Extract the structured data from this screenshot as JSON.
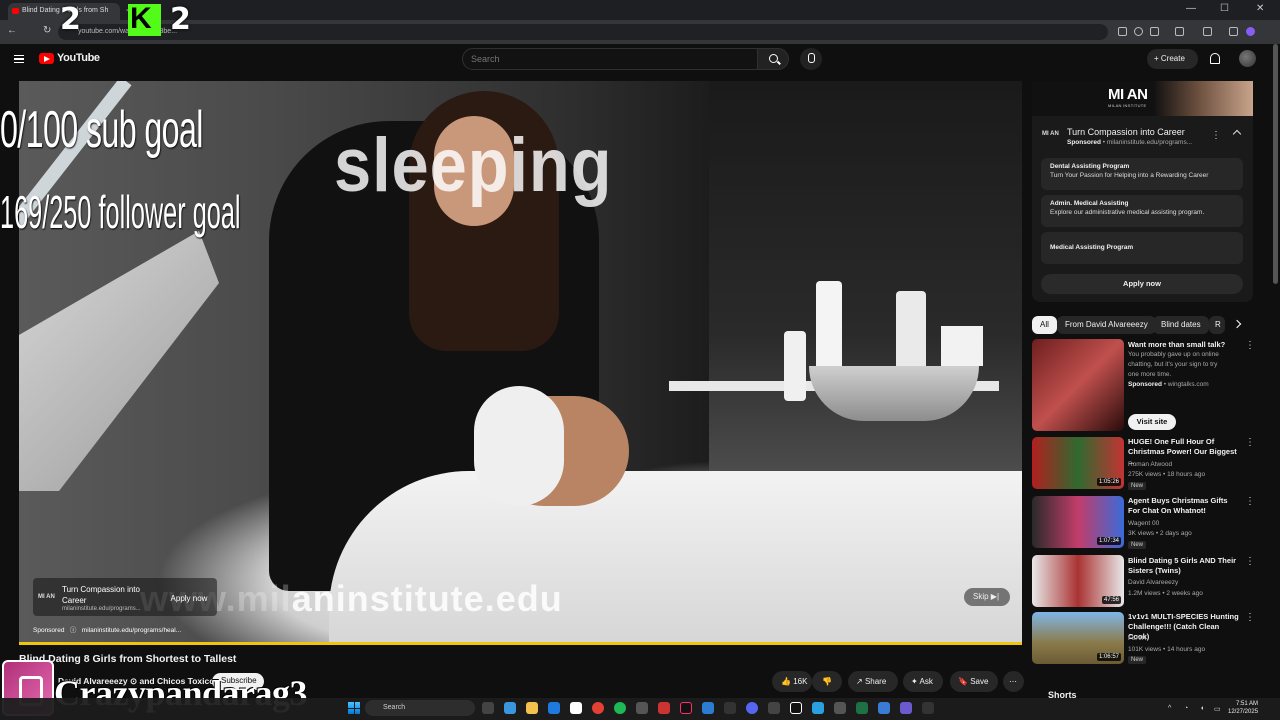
{
  "browser": {
    "tab_title": "Blind Dating 8 Girls from Sh",
    "url": "youtube.com/watch?v=...13be...",
    "new_tab": "+",
    "win_minimize": "—",
    "win_maximize": "☐",
    "win_close": "✕",
    "back": "←",
    "reload": "↻"
  },
  "stream_overlay": {
    "counter_1": "2",
    "kick_letter": "K",
    "counter_2": "2",
    "sub_goal": "0/100 sub goal",
    "follower_goal": "169/250 follower goal",
    "sleeping": "sleeping",
    "streamer_name": "Crazypandarag3"
  },
  "masthead": {
    "logo_text": "YouTube",
    "search_placeholder": "Search",
    "create_label": "Create"
  },
  "player": {
    "watermark_dim": "www.mil",
    "watermark_text": "aninstitute.edu",
    "ad_logo": "MI AN",
    "ad_title": "Turn Compassion into Career",
    "ad_url": "milaninstitute.edu/programs...",
    "ad_apply": "Apply now",
    "sponsored_label": "Sponsored",
    "sponsored_info": "ⓘ",
    "sponsored_url": "milaninstitute.edu/programs/heal...",
    "skip_label": "Skip",
    "skip_icon": "▶|",
    "progress_color": "#f1c40f"
  },
  "video": {
    "title": "Blind Dating 8 Girls from Shortest to Tallest",
    "channel": "David Alvareeezy",
    "collab": "and Chicos Toxicos",
    "subscribe_label": "Subscribe",
    "likes": "16K",
    "share_label": "Share",
    "ask_label": "Ask",
    "save_label": "Save",
    "more": "⋯"
  },
  "sidebar_ad": {
    "banner_logo": "MI AN",
    "banner_sub": "MILAN INSTITUTE",
    "logo": "MI AN",
    "title": "Turn Compassion into Career",
    "sponsored": "Sponsored",
    "domain": "milaninstitute.edu/programs...",
    "programs": [
      {
        "title": "Dental Assisting Program",
        "desc": "Turn Your Passion for Helping into a Rewarding Career"
      },
      {
        "title": "Admin. Medical Assisting",
        "desc": "Explore our administrative medical assisting program."
      },
      {
        "title": "Medical Assisting Program",
        "desc": ""
      }
    ],
    "apply_label": "Apply now"
  },
  "chips": [
    "All",
    "From David Alvareeezy",
    "Blind dates",
    "R"
  ],
  "recommendations": [
    {
      "title": "Want more than small talk?",
      "desc": "You probably gave up on online chatting, but it's your sign to try one more time.",
      "sponsored": "Sponsored",
      "domain": "wingtalks.com",
      "action": "Visit site"
    },
    {
      "title": "HUGE! One Full Hour Of Christmas Power! Our Biggest ...",
      "channel": "Roman Atwood",
      "meta": "275K views • 18 hours ago",
      "badge": "New",
      "duration": "1:05:26"
    },
    {
      "title": "Agent Buys Christmas Gifts For Chat On Whatnot!",
      "channel": "Wagent 00",
      "meta": "3K views • 2 days ago",
      "badge": "New",
      "duration": "1:07:34"
    },
    {
      "title": "Blind Dating 5 Girls AND Their Sisters (Twins)",
      "channel": "David Alvareeezy",
      "meta": "1.2M views • 2 weeks ago",
      "badge": "",
      "duration": "47:56"
    },
    {
      "title": "1v1v1 MULTI-SPECIES Hunting Challenge!!! (Catch Clean Cook)",
      "channel": "FLAIR",
      "meta": "101K views • 14 hours ago",
      "badge": "New",
      "duration": "1:06:57"
    }
  ],
  "shorts_label": "Shorts",
  "taskbar": {
    "search": "Search",
    "time": "7:51 AM",
    "date": "12/27/2025"
  }
}
